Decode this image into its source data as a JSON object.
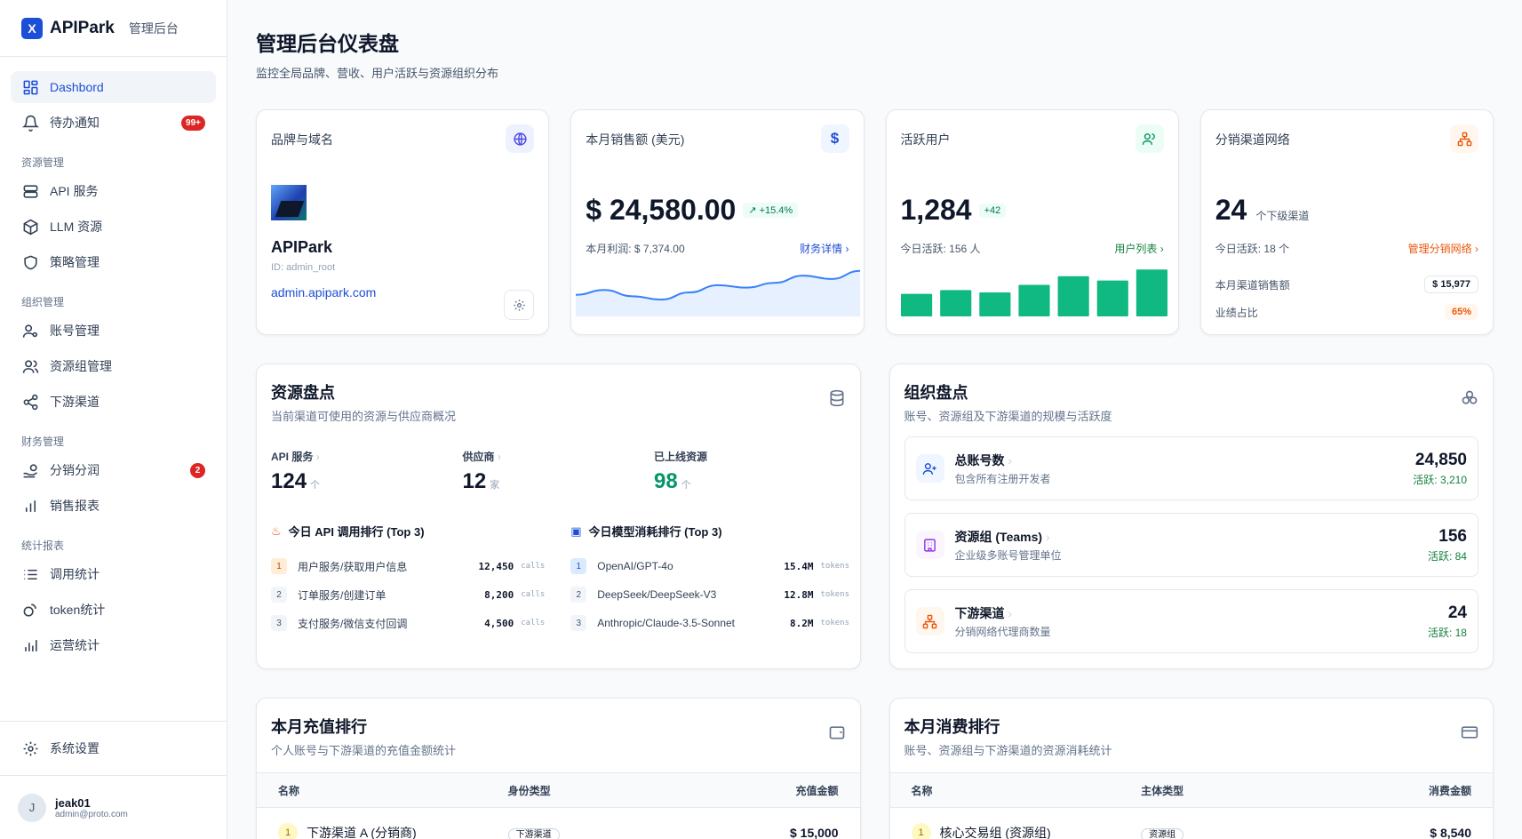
{
  "sidebar": {
    "logo": "X",
    "brand": "APIPark",
    "brand_sub": "管理后台",
    "items": {
      "dashboard": "Dashbord",
      "todo": "待办通知",
      "todo_badge": "99+",
      "sec_resource": "资源管理",
      "api": "API 服务",
      "llm": "LLM 资源",
      "policy": "策略管理",
      "sec_org": "组织管理",
      "account": "账号管理",
      "team": "资源组管理",
      "channel": "下游渠道",
      "sec_finance": "财务管理",
      "split": "分销分润",
      "split_badge": "2",
      "sales": "销售报表",
      "sec_stats": "统计报表",
      "calls": "调用统计",
      "token": "token统计",
      "ops": "运营统计"
    },
    "settings": "系统设置",
    "user": {
      "initial": "J",
      "name": "jeak01",
      "email": "admin@proto.com"
    }
  },
  "header": {
    "title": "管理后台仪表盘",
    "subtitle": "监控全局品牌、营收、用户活跃与资源组织分布"
  },
  "cards": {
    "brand": {
      "title": "品牌与域名",
      "name": "APIPark",
      "id": "ID: admin_root",
      "domain": "admin.apipark.com"
    },
    "sales": {
      "title": "本月销售额 (美元)",
      "value": "$ 24,580.00",
      "delta": "↗ +15.4%",
      "profit": "本月利润: $ 7,374.00",
      "link": "财务详情 ›"
    },
    "users": {
      "title": "活跃用户",
      "value": "1,284",
      "delta": "+42",
      "today": "今日活跃: 156 人",
      "link": "用户列表 ›"
    },
    "network": {
      "title": "分销渠道网络",
      "value": "24",
      "unit": "个下级渠道",
      "today": "今日活跃: 18 个",
      "link": "管理分销网络 ›",
      "sales_label": "本月渠道销售额",
      "sales_val": "$ 15,977",
      "share_label": "业绩占比",
      "share_val": "65%"
    }
  },
  "colors": {
    "accent": "#1d4ed8",
    "green": "#10b981",
    "orange": "#ea580c"
  },
  "chart_data": [
    {
      "type": "area",
      "values": [
        0.45,
        0.55,
        0.42,
        0.35,
        0.5,
        0.65,
        0.6,
        0.7,
        0.85,
        0.78,
        0.95
      ]
    },
    {
      "type": "bar",
      "values": [
        47,
        55,
        50,
        66,
        84,
        75,
        98
      ]
    }
  ],
  "resource": {
    "title": "资源盘点",
    "subtitle": "当前渠道可使用的资源与供应商概况",
    "api_label": "API 服务",
    "api_val": "124",
    "api_unit": "个",
    "vendor_label": "供应商",
    "vendor_val": "12",
    "vendor_unit": "家",
    "online_label": "已上线资源",
    "online_val": "98",
    "online_unit": "个",
    "api_rank_title": "今日 API 调用排行 (Top 3)",
    "api_rank": [
      {
        "n": "1",
        "name": "用户服务/获取用户信息",
        "val": "12,450",
        "unit": "calls"
      },
      {
        "n": "2",
        "name": "订单服务/创建订单",
        "val": "8,200",
        "unit": "calls"
      },
      {
        "n": "3",
        "name": "支付服务/微信支付回调",
        "val": "4,500",
        "unit": "calls"
      }
    ],
    "model_rank_title": "今日模型消耗排行 (Top 3)",
    "model_rank": [
      {
        "n": "1",
        "name": "OpenAI/GPT-4o",
        "val": "15.4M",
        "unit": "tokens"
      },
      {
        "n": "2",
        "name": "DeepSeek/DeepSeek-V3",
        "val": "12.8M",
        "unit": "tokens"
      },
      {
        "n": "3",
        "name": "Anthropic/Claude-3.5-Sonnet",
        "val": "8.2M",
        "unit": "tokens"
      }
    ]
  },
  "org": {
    "title": "组织盘点",
    "subtitle": "账号、资源组及下游渠道的规模与活跃度",
    "rows": [
      {
        "name": "总账号数",
        "desc": "包含所有注册开发者",
        "val": "24,850",
        "act": "活跃: 3,210"
      },
      {
        "name": "资源组 (Teams)",
        "desc": "企业级多账号管理单位",
        "val": "156",
        "act": "活跃: 84"
      },
      {
        "name": "下游渠道",
        "desc": "分销网络代理商数量",
        "val": "24",
        "act": "活跃: 18"
      }
    ]
  },
  "recharge": {
    "title": "本月充值排行",
    "subtitle": "个人账号与下游渠道的充值金额统计",
    "cols": [
      "名称",
      "身份类型",
      "充值金额"
    ],
    "rows": [
      {
        "n": "1",
        "name": "下游渠道 A (分销商)",
        "type": "下游渠道",
        "amount": "$ 15,000"
      }
    ]
  },
  "consume": {
    "title": "本月消费排行",
    "subtitle": "账号、资源组与下游渠道的资源消耗统计",
    "cols": [
      "名称",
      "主体类型",
      "消费金额"
    ],
    "rows": [
      {
        "n": "1",
        "name": "核心交易组 (资源组)",
        "type": "资源组",
        "amount": "$ 8,540"
      }
    ]
  }
}
